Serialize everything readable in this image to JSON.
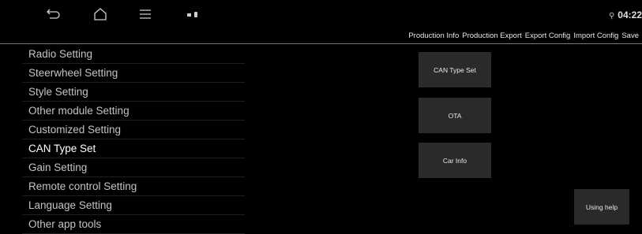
{
  "status": {
    "time": "04:22"
  },
  "toolbar": [
    "Production Info",
    "Production Export",
    "Export Config",
    "Import Config",
    "Save"
  ],
  "menu": [
    {
      "label": "Radio Setting"
    },
    {
      "label": "Steerwheel Setting"
    },
    {
      "label": "Style Setting"
    },
    {
      "label": "Other module Setting"
    },
    {
      "label": "Customized Setting"
    },
    {
      "label": "CAN Type Set",
      "active": true
    },
    {
      "label": "Gain Setting"
    },
    {
      "label": "Remote control Setting"
    },
    {
      "label": "Language Setting"
    },
    {
      "label": "Other app tools"
    }
  ],
  "buttons": {
    "can_type_set": "CAN Type Set",
    "ota": "OTA",
    "car_info": "Car Info",
    "using_help": "Using help"
  },
  "icons": [
    "back-icon",
    "home-icon",
    "menu-icon",
    "notification-icon",
    "location-icon"
  ]
}
